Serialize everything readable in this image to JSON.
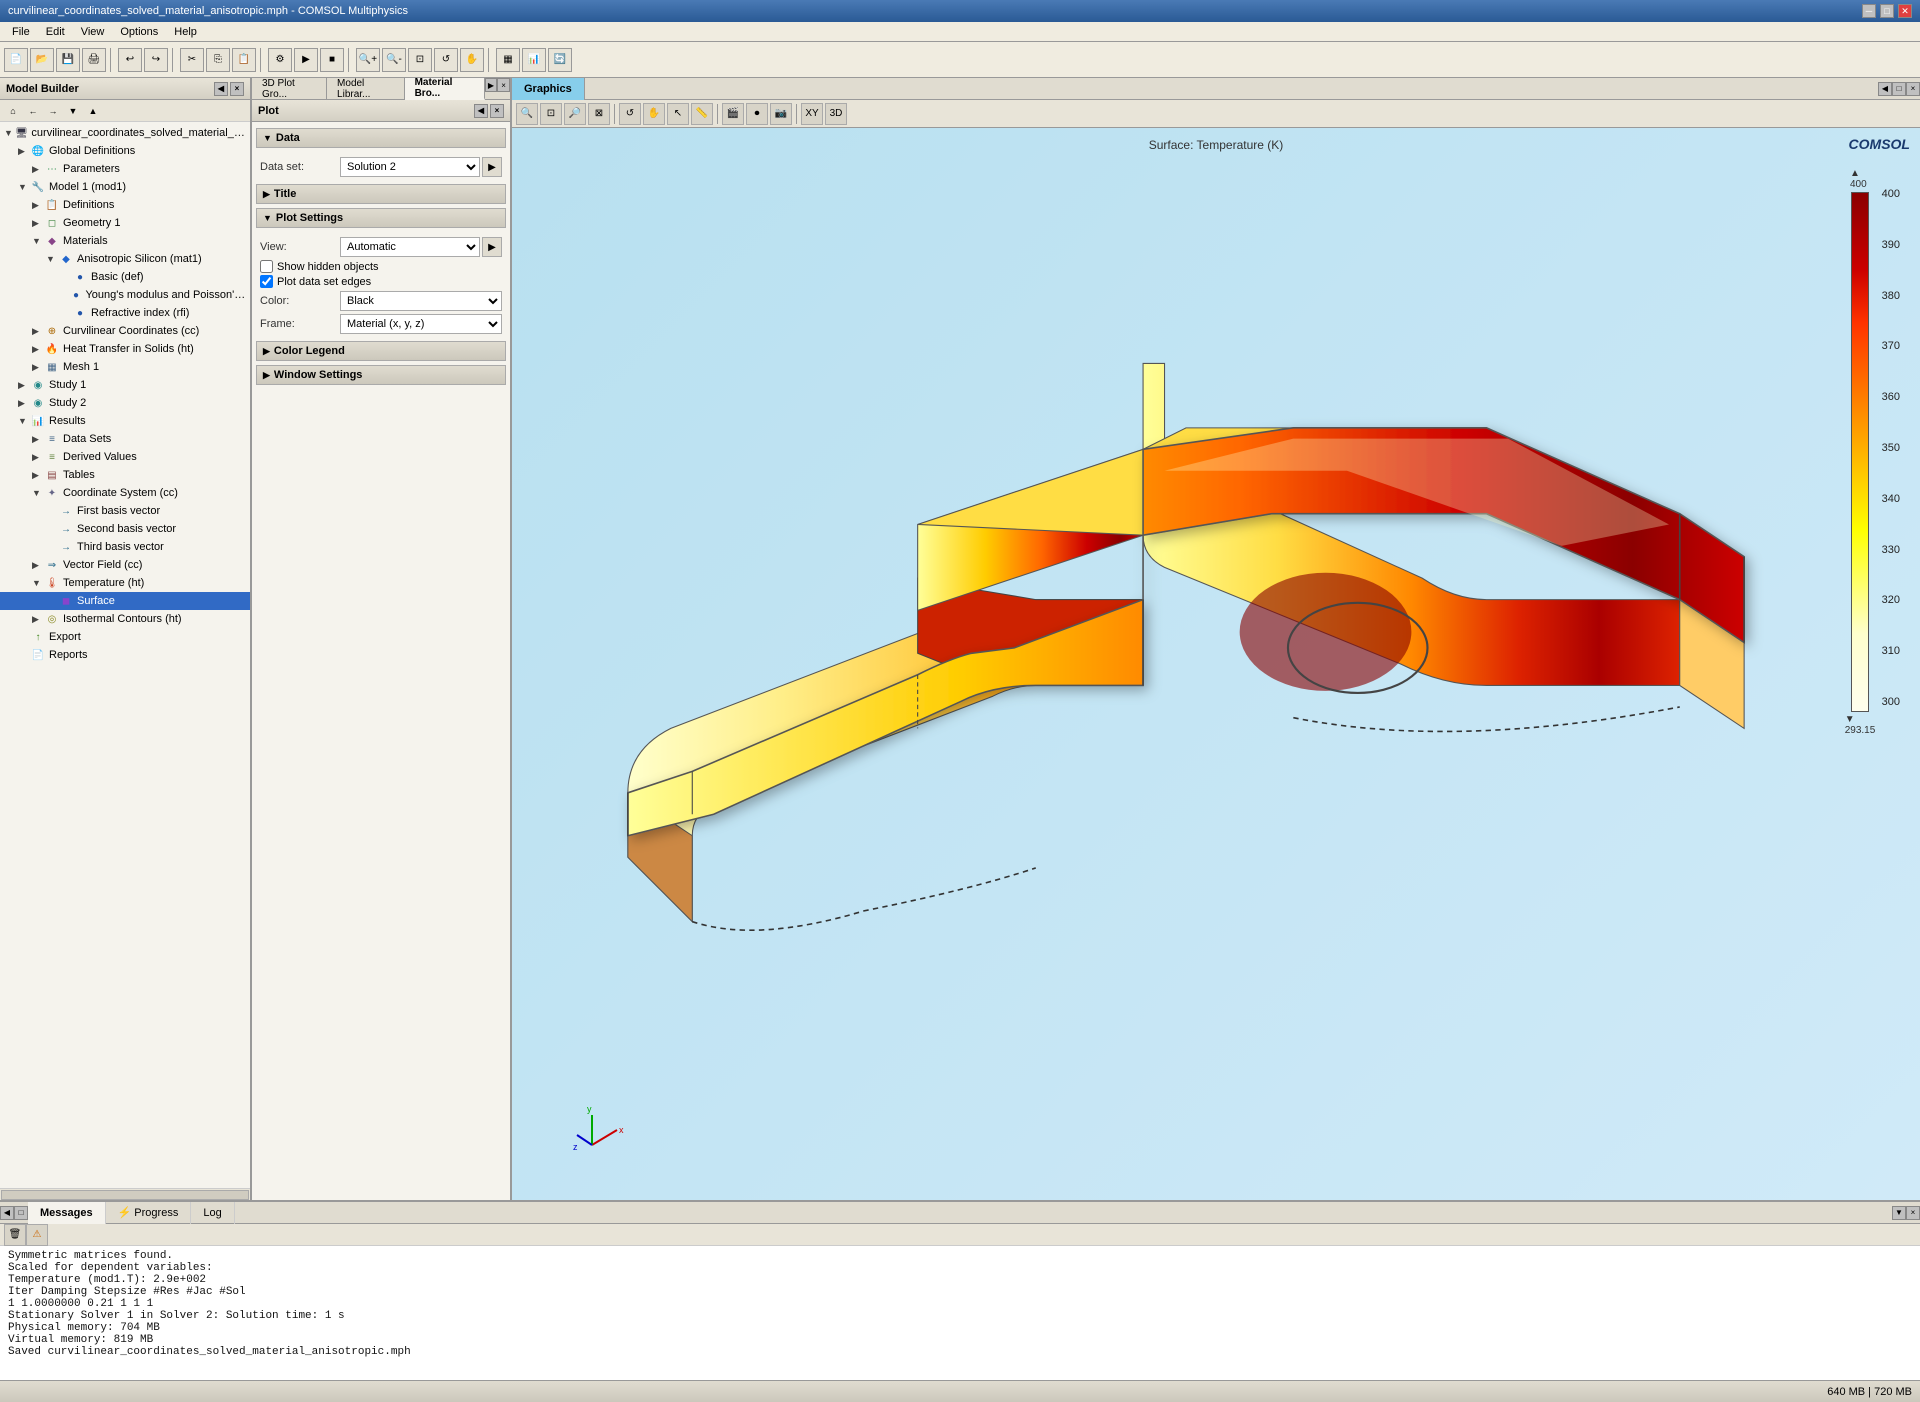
{
  "titlebar": {
    "title": "curvilinear_coordinates_solved_material_anisotropic.mph - COMSOL Multiphysics",
    "min": "─",
    "max": "□",
    "close": "✕"
  },
  "menubar": {
    "items": [
      "File",
      "Edit",
      "View",
      "Options",
      "Help"
    ]
  },
  "panels": {
    "model_builder": {
      "title": "Model Builder",
      "toolbar_icons": [
        "←",
        "→",
        "↑",
        "↓",
        "≡"
      ]
    },
    "middle": {
      "tabs": [
        "3D Plot Gro...",
        "Model Librar...",
        "Material Bro..."
      ],
      "active_tab": 2,
      "plot_header": "Plot",
      "sections": {
        "data": {
          "label": "Data",
          "dataset_label": "Data set:",
          "dataset_value": "Solution 2"
        },
        "title": {
          "label": "Title"
        },
        "plot_settings": {
          "label": "Plot Settings",
          "view_label": "View:",
          "view_value": "Automatic",
          "show_hidden": "Show hidden objects",
          "plot_edges": "Plot data set edges",
          "color_label": "Color:",
          "color_value": "Black",
          "frame_label": "Frame:",
          "frame_value": "Material (x, y, z)"
        },
        "color_legend": {
          "label": "Color Legend"
        },
        "window_settings": {
          "label": "Window Settings"
        }
      }
    },
    "graphics": {
      "title": "Graphics",
      "surface_label": "Surface: Temperature (K)"
    }
  },
  "tree": {
    "items": [
      {
        "id": "root",
        "label": "curvilinear_coordinates_solved_material_anisotro...",
        "indent": 0,
        "icon": "🖥",
        "type": "root",
        "expanded": true
      },
      {
        "id": "global-def",
        "label": "Global Definitions",
        "indent": 1,
        "icon": "🌐",
        "type": "global",
        "expanded": false
      },
      {
        "id": "parameters",
        "label": "Parameters",
        "indent": 2,
        "icon": "P",
        "type": "param",
        "expanded": false
      },
      {
        "id": "model1",
        "label": "Model 1 (mod1)",
        "indent": 1,
        "icon": "M",
        "type": "model",
        "expanded": true
      },
      {
        "id": "definitions",
        "label": "Definitions",
        "indent": 2,
        "icon": "D",
        "type": "def",
        "expanded": false
      },
      {
        "id": "geometry1",
        "label": "Geometry 1",
        "indent": 2,
        "icon": "G",
        "type": "geom",
        "expanded": false
      },
      {
        "id": "materials",
        "label": "Materials",
        "indent": 2,
        "icon": "◆",
        "type": "mat",
        "expanded": true
      },
      {
        "id": "aniso-silicon",
        "label": "Anisotropic Silicon (mat1)",
        "indent": 3,
        "icon": "◆",
        "type": "mat-item",
        "expanded": true
      },
      {
        "id": "basic",
        "label": "Basic (def)",
        "indent": 4,
        "icon": "●",
        "type": "mat-sub"
      },
      {
        "id": "youngs",
        "label": "Young's modulus and Poisson's ratio (Er...",
        "indent": 4,
        "icon": "●",
        "type": "mat-sub"
      },
      {
        "id": "refractive",
        "label": "Refractive index (rfi)",
        "indent": 4,
        "icon": "●",
        "type": "mat-sub"
      },
      {
        "id": "curvilinear",
        "label": "Curvilinear Coordinates (cc)",
        "indent": 2,
        "icon": "🔶",
        "type": "coord",
        "expanded": false
      },
      {
        "id": "heat-transfer",
        "label": "Heat Transfer in Solids (ht)",
        "indent": 2,
        "icon": "🔥",
        "type": "ht",
        "expanded": false
      },
      {
        "id": "mesh1",
        "label": "Mesh 1",
        "indent": 2,
        "icon": "▦",
        "type": "mesh",
        "expanded": false
      },
      {
        "id": "study1",
        "label": "Study 1",
        "indent": 1,
        "icon": "◉",
        "type": "study",
        "expanded": false
      },
      {
        "id": "study2",
        "label": "Study 2",
        "indent": 1,
        "icon": "◉",
        "type": "study",
        "expanded": false
      },
      {
        "id": "results",
        "label": "Results",
        "indent": 1,
        "icon": "📊",
        "type": "results",
        "expanded": true
      },
      {
        "id": "data-sets",
        "label": "Data Sets",
        "indent": 2,
        "icon": "≡",
        "type": "ds",
        "expanded": false
      },
      {
        "id": "derived-vals",
        "label": "Derived Values",
        "indent": 2,
        "icon": "≡",
        "type": "dv",
        "expanded": false
      },
      {
        "id": "tables",
        "label": "Tables",
        "indent": 2,
        "icon": "▤",
        "type": "tbl",
        "expanded": false
      },
      {
        "id": "coord-sys",
        "label": "Coordinate System (cc)",
        "indent": 2,
        "icon": "◈",
        "type": "cs",
        "expanded": true
      },
      {
        "id": "first-basis",
        "label": "First basis vector",
        "indent": 3,
        "icon": "→",
        "type": "vec"
      },
      {
        "id": "second-basis",
        "label": "Second basis vector",
        "indent": 3,
        "icon": "→",
        "type": "vec"
      },
      {
        "id": "third-basis",
        "label": "Third basis vector",
        "indent": 3,
        "icon": "→",
        "type": "vec"
      },
      {
        "id": "vector-field",
        "label": "Vector Field (cc)",
        "indent": 2,
        "icon": "⇒",
        "type": "vec-f",
        "expanded": false
      },
      {
        "id": "temperature",
        "label": "Temperature (ht)",
        "indent": 2,
        "icon": "🌡",
        "type": "temp",
        "expanded": true
      },
      {
        "id": "surface",
        "label": "Surface",
        "indent": 3,
        "icon": "◼",
        "type": "surf",
        "selected": true
      },
      {
        "id": "isothermal",
        "label": "Isothermal Contours (ht)",
        "indent": 2,
        "icon": "◎",
        "type": "iso",
        "expanded": false
      },
      {
        "id": "export",
        "label": "Export",
        "indent": 1,
        "icon": "↑",
        "type": "exp"
      },
      {
        "id": "reports",
        "label": "Reports",
        "indent": 1,
        "icon": "📄",
        "type": "rep"
      }
    ]
  },
  "colorbar": {
    "max_label": "▲ 400",
    "labels": [
      "400",
      "390",
      "380",
      "370",
      "360",
      "350",
      "340",
      "330",
      "320",
      "310",
      "300"
    ],
    "min_label": "▼ 293.15"
  },
  "bottom_panel": {
    "tabs": [
      "Messages",
      "Progress",
      "Log"
    ],
    "messages": [
      "Symmetric matrices found.",
      "Scaled for dependent variables:",
      "Temperature (mod1.T): 2.9e+002",
      "Iter    Damping      Stepsize  #Res  #Jac  #Sol",
      "  1     1.0000000        0.21     1     1     1",
      "Stationary Solver 1 in Solver 2: Solution time: 1 s",
      "                                 Physical memory: 704 MB",
      "                                 Virtual memory: 819 MB",
      "Saved curvilinear_coordinates_solved_material_anisotropic.mph"
    ]
  },
  "status_bar": {
    "memory": "640 MB | 720 MB"
  },
  "icons": {
    "search": "🔍",
    "zoom_in": "+",
    "zoom_out": "-",
    "fit": "⊡",
    "rotate": "↺",
    "pan": "✋",
    "save": "💾"
  }
}
